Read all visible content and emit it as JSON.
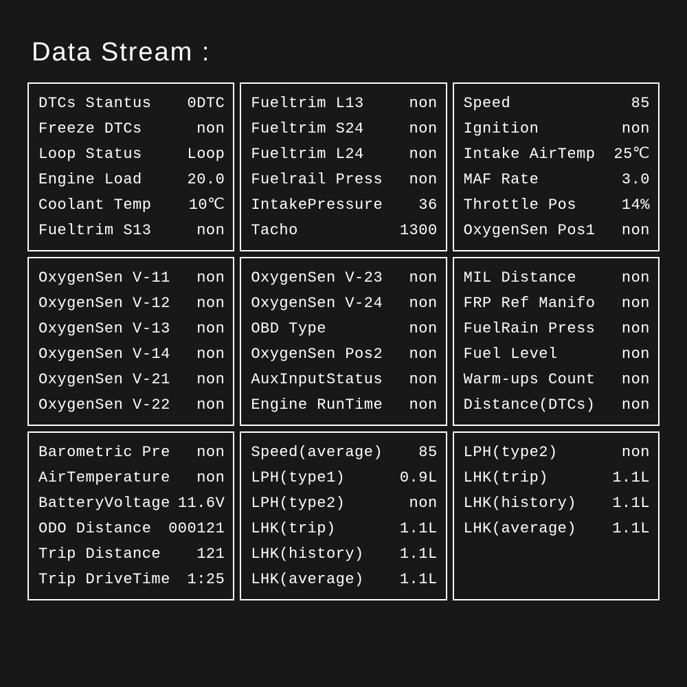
{
  "title": "Data Stream  :",
  "panels": [
    {
      "rows": [
        {
          "label": "DTCs  Stantus",
          "value": "0DTC"
        },
        {
          "label": "Freeze DTCs",
          "value": "non"
        },
        {
          "label": "Loop  Status",
          "value": "Loop"
        },
        {
          "label": "Engine Load",
          "value": "20.0"
        },
        {
          "label": "Coolant  Temp",
          "value": "10℃"
        },
        {
          "label": "Fueltrim S13",
          "value": "non"
        }
      ]
    },
    {
      "rows": [
        {
          "label": "Fueltrim L13",
          "value": "non"
        },
        {
          "label": "Fueltrim S24",
          "value": "non"
        },
        {
          "label": "Fueltrim L24",
          "value": "non"
        },
        {
          "label": "Fuelrail Press",
          "value": "non"
        },
        {
          "label": "IntakePressure",
          "value": "36"
        },
        {
          "label": "Tacho",
          "value": "1300"
        }
      ]
    },
    {
      "rows": [
        {
          "label": "Speed",
          "value": "85"
        },
        {
          "label": "Ignition",
          "value": "non"
        },
        {
          "label": "Intake AirTemp",
          "value": "25℃"
        },
        {
          "label": "MAF Rate",
          "value": "3.0"
        },
        {
          "label": "Throttle Pos",
          "value": "14%"
        },
        {
          "label": "OxygenSen Pos1",
          "value": "non"
        }
      ]
    },
    {
      "rows": [
        {
          "label": "OxygenSen V-11",
          "value": "non"
        },
        {
          "label": "OxygenSen V-12",
          "value": "non"
        },
        {
          "label": "OxygenSen V-13",
          "value": "non"
        },
        {
          "label": "OxygenSen V-14",
          "value": "non"
        },
        {
          "label": "OxygenSen V-21",
          "value": "non"
        },
        {
          "label": "OxygenSen V-22",
          "value": "non"
        }
      ]
    },
    {
      "rows": [
        {
          "label": "OxygenSen V-23",
          "value": "non"
        },
        {
          "label": "OxygenSen V-24",
          "value": "non"
        },
        {
          "label": "OBD Type",
          "value": "non"
        },
        {
          "label": "OxygenSen Pos2",
          "value": "non"
        },
        {
          "label": "AuxInputStatus",
          "value": "non"
        },
        {
          "label": "Engine RunTime",
          "value": "non"
        }
      ]
    },
    {
      "rows": [
        {
          "label": "MIL   Distance",
          "value": "non"
        },
        {
          "label": "FRP Ref Manifo",
          "value": "non"
        },
        {
          "label": "FuelRain Press",
          "value": "non"
        },
        {
          "label": "Fuel Level",
          "value": "non"
        },
        {
          "label": "Warm-ups Count",
          "value": "non"
        },
        {
          "label": "Distance(DTCs)",
          "value": "non"
        }
      ]
    },
    {
      "rows": [
        {
          "label": "Barometric Pre",
          "value": "non"
        },
        {
          "label": "AirTemperature",
          "value": "non"
        },
        {
          "label": "BatteryVoltage",
          "value": "11.6V"
        },
        {
          "label": "ODO Distance",
          "value": "000121"
        },
        {
          "label": "Trip Distance",
          "value": "121"
        },
        {
          "label": "Trip DriveTime",
          "value": "1:25"
        }
      ]
    },
    {
      "rows": [
        {
          "label": "Speed(average)",
          "value": "85"
        },
        {
          "label": "LPH(type1)",
          "value": "0.9L"
        },
        {
          "label": "LPH(type2)",
          "value": "non"
        },
        {
          "label": "LHK(trip)",
          "value": "1.1L"
        },
        {
          "label": "LHK(history)",
          "value": "1.1L"
        },
        {
          "label": "LHK(average)",
          "value": "1.1L"
        }
      ]
    },
    {
      "short": true,
      "rows": [
        {
          "label": "LPH(type2)",
          "value": "non"
        },
        {
          "label": "LHK(trip)",
          "value": "1.1L"
        },
        {
          "label": "LHK(history)",
          "value": "1.1L"
        },
        {
          "label": "LHK(average)",
          "value": "1.1L"
        }
      ]
    }
  ]
}
